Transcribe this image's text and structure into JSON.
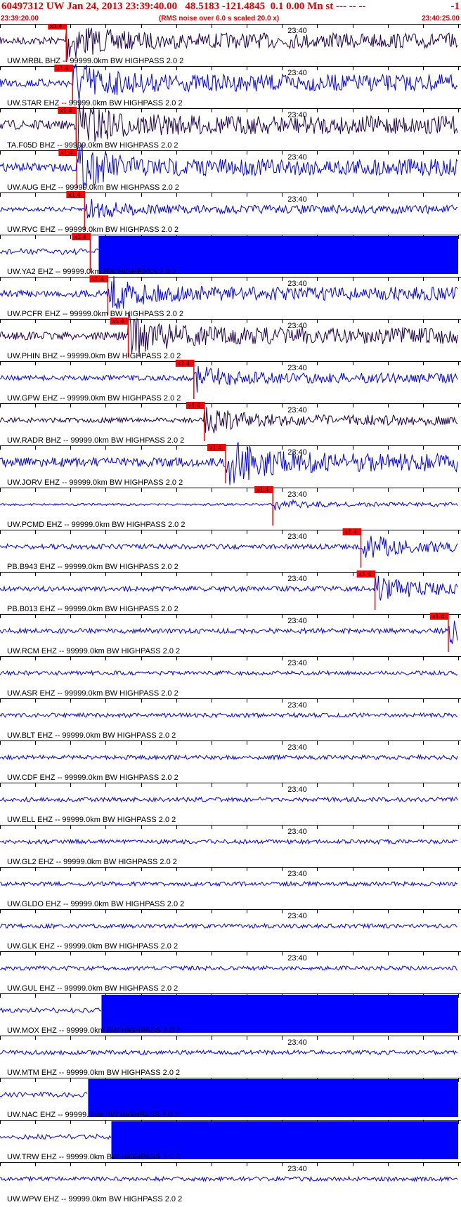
{
  "header": {
    "title": "60497312 UW Jan 24, 2013 23:39:40.00   48.5183 -121.4845  0.1 0.00 Mn st --- -- --",
    "right": "-1",
    "start_time": "23:39:20.00",
    "note": "(RMS noise over 6.0 s scaled 20.0 x)",
    "end_time": "23:40:25.00"
  },
  "colors": {
    "trace_blue": "#0000ff",
    "trace_dark": "#1e0050",
    "pick": "#ff0000",
    "axis": "#000000",
    "header_text": "#e00000"
  },
  "chart_data": {
    "type": "line",
    "title": "60497312 UW Jan 24, 2013 23:39:40.00",
    "x_range": [
      "23:39:20.00",
      "23:40:25.00"
    ],
    "time_marker": "23:40",
    "pick_label": "x1.4",
    "traces": [
      {
        "label": "UW.MRBL BHZ -- 99999.0km BW  HIGHPASS  2.0  2",
        "color": "dark",
        "amp": 0.18,
        "pick_s": 9.4,
        "energy_s": 9.4,
        "saturated": false
      },
      {
        "label": "UW.STAR EHZ -- 99999.0km BW  HIGHPASS  2.0  2",
        "color": "blue",
        "amp": 0.2,
        "pick_s": 10.3,
        "energy_s": 10.3,
        "saturated": false
      },
      {
        "label": "TA.F05D BHZ -- 99999.0km BW  HIGHPASS  2.0  2",
        "color": "dark",
        "amp": 0.22,
        "pick_s": 10.8,
        "energy_s": 10.8,
        "saturated": false
      },
      {
        "label": "UW.AUG EHZ -- 99999.0km BW  HIGHPASS  2.0  2",
        "color": "blue",
        "amp": 0.2,
        "pick_s": 10.9,
        "energy_s": 10.9,
        "saturated": false
      },
      {
        "label": "UW.RVC EHZ -- 99999.0km BW  HIGHPASS  2.0  2",
        "color": "blue",
        "amp": 0.1,
        "pick_s": 12.0,
        "energy_s": 12.0,
        "saturated": false
      },
      {
        "label": "UW.YA2 EHZ -- 99999.0km BW  HIGHPASS  2.0  2",
        "color": "blue",
        "amp": 0.12,
        "pick_s": 12.8,
        "energy_s": 14.0,
        "saturated": true
      },
      {
        "label": "UW.PCFR EHZ -- 99999.0km BW  HIGHPASS  2.0  2",
        "color": "blue",
        "amp": 0.16,
        "pick_s": 15.3,
        "energy_s": 15.3,
        "saturated": false
      },
      {
        "label": "UW.PHIN BHZ -- 99999.0km BW  HIGHPASS  2.0  2",
        "color": "dark",
        "amp": 0.2,
        "pick_s": 18.2,
        "energy_s": 18.2,
        "saturated": false
      },
      {
        "label": "UW.GPW EHZ -- 99999.0km BW  HIGHPASS  2.0  2",
        "color": "blue",
        "amp": 0.12,
        "pick_s": 27.5,
        "energy_s": 27.5,
        "saturated": false
      },
      {
        "label": "UW.RADR BHZ -- 99999.0km BW  HIGHPASS  2.0  2",
        "color": "dark",
        "amp": 0.12,
        "pick_s": 29.0,
        "energy_s": 29.0,
        "saturated": false
      },
      {
        "label": "UW.JORV EHZ -- 99999.0km BW  HIGHPASS  2.0  2",
        "color": "blue",
        "amp": 0.22,
        "pick_s": 32.0,
        "energy_s": 32.0,
        "saturated": false
      },
      {
        "label": "UW.PCMD EHZ -- 99999.0km BW  HIGHPASS  2.0  2",
        "color": "blue",
        "amp": 0.05,
        "pick_s": 38.7,
        "energy_s": 38.7,
        "saturated": false
      },
      {
        "label": "PB.B943 EHZ -- 99999.0km BW  HIGHPASS  2.0  2",
        "color": "blue",
        "amp": 0.12,
        "pick_s": 51.2,
        "energy_s": 51.2,
        "saturated": false
      },
      {
        "label": "PB.B013 EHZ -- 99999.0km BW  HIGHPASS  2.0  2",
        "color": "blue",
        "amp": 0.12,
        "pick_s": 53.2,
        "energy_s": 53.2,
        "saturated": false
      },
      {
        "label": "UW.RCM EHZ -- 99999.0km BW  HIGHPASS  2.0  2",
        "color": "blue",
        "amp": 0.12,
        "pick_s": 63.6,
        "energy_s": 63.6,
        "saturated": false
      },
      {
        "label": "UW.ASR EHZ -- 99999.0km BW  HIGHPASS  2.0  2",
        "color": "blue",
        "amp": 0.1,
        "pick_s": null,
        "energy_s": null,
        "saturated": false
      },
      {
        "label": "UW.BLT EHZ -- 99999.0km BW  HIGHPASS  2.0  2",
        "color": "blue",
        "amp": 0.1,
        "pick_s": null,
        "energy_s": null,
        "saturated": false
      },
      {
        "label": "UW.CDF EHZ -- 99999.0km BW  HIGHPASS  2.0  2",
        "color": "blue",
        "amp": 0.1,
        "pick_s": null,
        "energy_s": null,
        "saturated": false
      },
      {
        "label": "UW.ELL EHZ -- 99999.0km BW  HIGHPASS  2.0  2",
        "color": "blue",
        "amp": 0.1,
        "pick_s": null,
        "energy_s": null,
        "saturated": false
      },
      {
        "label": "UW.GL2 EHZ -- 99999.0km BW  HIGHPASS  2.0  2",
        "color": "blue",
        "amp": 0.1,
        "pick_s": null,
        "energy_s": null,
        "saturated": false
      },
      {
        "label": "UW.GLDO EHZ -- 99999.0km BW  HIGHPASS  2.0  2",
        "color": "blue",
        "amp": 0.1,
        "pick_s": null,
        "energy_s": null,
        "saturated": false
      },
      {
        "label": "UW.GLK EHZ -- 99999.0km BW  HIGHPASS  2.0  2",
        "color": "blue",
        "amp": 0.1,
        "pick_s": null,
        "energy_s": null,
        "saturated": false
      },
      {
        "label": "UW.GUL EHZ -- 99999.0km BW  HIGHPASS  2.0  2",
        "color": "blue",
        "amp": 0.1,
        "pick_s": null,
        "energy_s": null,
        "saturated": false
      },
      {
        "label": "UW.MOX EHZ -- 99999.0km BW  HIGHPASS  2.0  2",
        "color": "blue",
        "amp": 0.1,
        "pick_s": null,
        "energy_s": 14.4,
        "saturated": true
      },
      {
        "label": "UW.MTM EHZ -- 99999.0km BW  HIGHPASS  2.0  2",
        "color": "blue",
        "amp": 0.1,
        "pick_s": null,
        "energy_s": null,
        "saturated": false
      },
      {
        "label": "UW.NAC EHZ -- 99999.0km BW  HIGHPASS  2.0  2",
        "color": "blue",
        "amp": 0.1,
        "pick_s": null,
        "energy_s": 12.5,
        "saturated": true
      },
      {
        "label": "UW.TRW EHZ -- 99999.0km BW  HIGHPASS  2.0  2",
        "color": "blue",
        "amp": 0.1,
        "pick_s": null,
        "energy_s": 15.8,
        "saturated": true
      },
      {
        "label": "UW.WPW EHZ -- 99999.0km BW  HIGHPASS  2.0  2",
        "color": "blue",
        "amp": 0.1,
        "pick_s": null,
        "energy_s": null,
        "saturated": false
      }
    ]
  }
}
